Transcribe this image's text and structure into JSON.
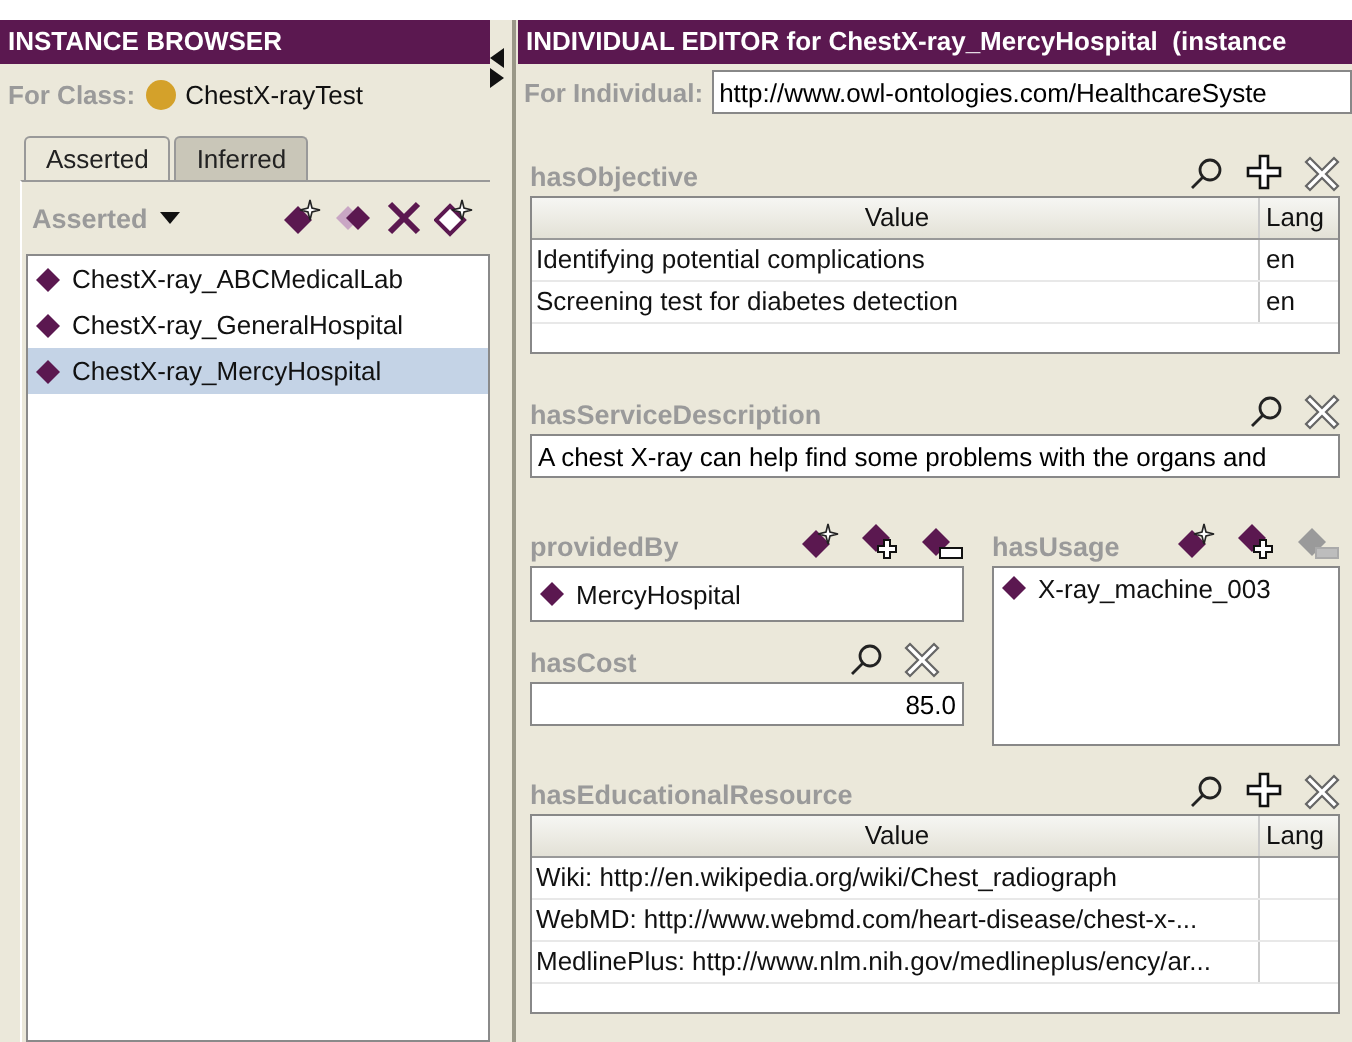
{
  "instance_browser": {
    "title": "INSTANCE BROWSER",
    "for_class_label": "For Class:",
    "class_name": "ChestX-rayTest",
    "tabs": [
      {
        "label": "Asserted",
        "selected": true
      },
      {
        "label": "Inferred",
        "selected": false
      }
    ],
    "list_label": "Asserted",
    "instances": [
      {
        "name": "ChestX-ray_ABCMedicalLab",
        "selected": false
      },
      {
        "name": "ChestX-ray_GeneralHospital",
        "selected": false
      },
      {
        "name": "ChestX-ray_MercyHospital",
        "selected": true
      }
    ]
  },
  "individual_editor": {
    "title": "INDIVIDUAL EDITOR for ChestX-ray_MercyHospital  (instance",
    "for_individual_label": "For Individual:",
    "iri": "http://www.owl-ontologies.com/HealthcareSyste",
    "has_objective": {
      "label": "hasObjective",
      "columns": [
        "Value",
        "Lang"
      ],
      "rows": [
        {
          "value": "Identifying potential complications",
          "lang": "en"
        },
        {
          "value": "Screening test for diabetes detection",
          "lang": "en"
        }
      ]
    },
    "service_description": {
      "label": "hasServiceDescription",
      "value": "A chest X-ray can help find some problems with the organs and"
    },
    "provided_by": {
      "label": "providedBy",
      "remove_disabled": false,
      "items": [
        "MercyHospital"
      ]
    },
    "has_cost": {
      "label": "hasCost",
      "value": "85.0"
    },
    "has_usage": {
      "label": "hasUsage",
      "remove_disabled": true,
      "items": [
        "X-ray_machine_003"
      ]
    },
    "educational_resource": {
      "label": "hasEducationalResource",
      "columns": [
        "Value",
        "Lang"
      ],
      "rows": [
        {
          "value": "Wiki: http://en.wikipedia.org/wiki/Chest_radiograph"
        },
        {
          "value": "WebMD: http://www.webmd.com/heart-disease/chest-x-..."
        },
        {
          "value": "MedlinePlus: http://www.nlm.nih.gov/medlineplus/ency/ar..."
        }
      ]
    }
  }
}
